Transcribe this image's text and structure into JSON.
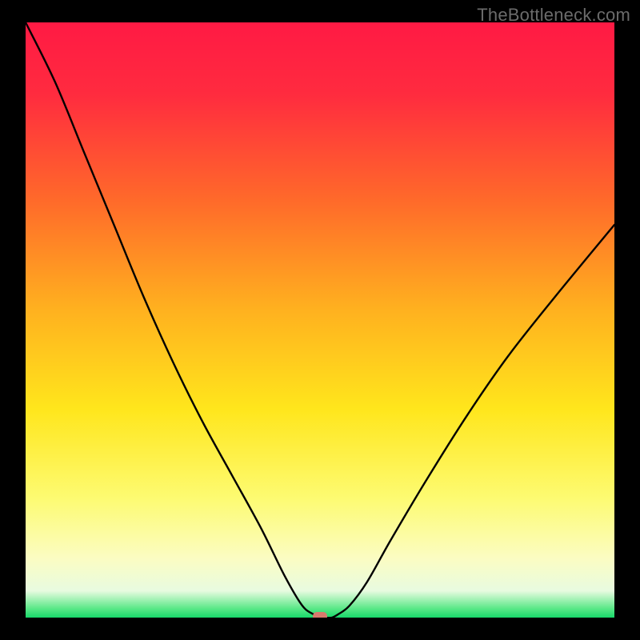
{
  "watermark": "TheBottleneck.com",
  "chart_data": {
    "type": "line",
    "title": "",
    "xlabel": "",
    "ylabel": "",
    "xlim": [
      0,
      100
    ],
    "ylim": [
      0,
      100
    ],
    "grid": false,
    "legend": false,
    "gradient_stops": [
      {
        "offset": 0.0,
        "color": "#ff1a44"
      },
      {
        "offset": 0.12,
        "color": "#ff2b3f"
      },
      {
        "offset": 0.3,
        "color": "#ff6a2a"
      },
      {
        "offset": 0.48,
        "color": "#ffb01f"
      },
      {
        "offset": 0.65,
        "color": "#ffe61c"
      },
      {
        "offset": 0.8,
        "color": "#fdfb72"
      },
      {
        "offset": 0.9,
        "color": "#fbfcc2"
      },
      {
        "offset": 0.955,
        "color": "#e8fbe0"
      },
      {
        "offset": 0.985,
        "color": "#59e887"
      },
      {
        "offset": 1.0,
        "color": "#18d86a"
      }
    ],
    "series": [
      {
        "name": "bottleneck-curve",
        "x": [
          0,
          5,
          10,
          15,
          20,
          25,
          30,
          35,
          40,
          44,
          47,
          49,
          50,
          51,
          52,
          53,
          55,
          58,
          62,
          68,
          75,
          82,
          90,
          100
        ],
        "values": [
          100,
          90,
          78,
          66,
          54,
          43,
          33,
          24,
          15,
          7,
          2,
          0.5,
          0,
          0,
          0,
          0.5,
          2,
          6,
          13,
          23,
          34,
          44,
          54,
          66
        ]
      }
    ],
    "marker": {
      "x": 50,
      "y": 0,
      "color": "#d77a6d"
    }
  }
}
